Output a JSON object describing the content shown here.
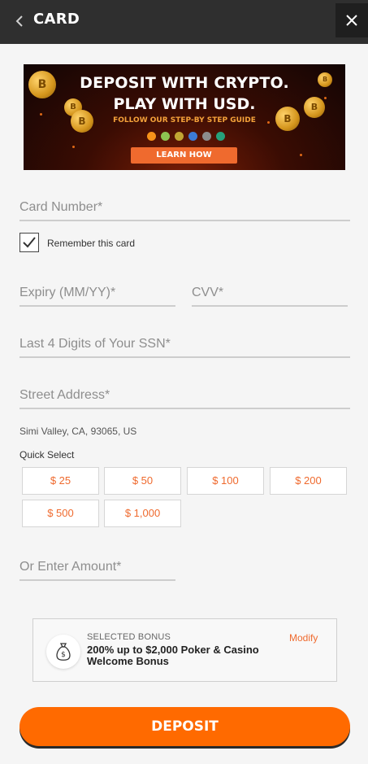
{
  "header": {
    "back_icon": "chevron-left-icon",
    "title": "CARD",
    "close_icon": "close-icon"
  },
  "banner": {
    "line1": "DEPOSIT WITH CRYPTO.",
    "line2": "PLAY WITH USD.",
    "guide": "FOLLOW OUR STEP-BY STEP GUIDE",
    "button_label": "LEARN HOW",
    "coin_letter": "B",
    "crypto_icons": [
      "bitcoin-icon",
      "bitcoin-cash-icon",
      "dogecoin-icon",
      "litecoin-icon",
      "ethereum-icon",
      "tether-icon"
    ],
    "crypto_colors": [
      "#f7931a",
      "#8dc351",
      "#c2a633",
      "#3c7bd6",
      "#8c8c8c",
      "#26a17b"
    ]
  },
  "form": {
    "card_number_placeholder": "Card Number*",
    "remember_label": "Remember this card",
    "remember_checked": true,
    "expiry_placeholder": "Expiry (MM/YY)*",
    "cvv_placeholder": "CVV*",
    "ssn_placeholder": "Last 4 Digits of Your SSN*",
    "street_placeholder": "Street Address*",
    "address_line": "Simi Valley, CA, 93065, US",
    "quick_select_label": "Quick Select",
    "quick_amounts": [
      "$ 25",
      "$ 50",
      "$ 100",
      "$ 200",
      "$ 500",
      "$ 1,000"
    ],
    "amount_placeholder": "Or Enter Amount*"
  },
  "bonus": {
    "icon": "money-bag-icon",
    "label": "SELECTED BONUS",
    "title": "200% up to $2,000 Poker & Casino Welcome Bonus",
    "modify_label": "Modify"
  },
  "deposit_label": "DEPOSIT",
  "colors": {
    "accent": "#ff6a00",
    "header_bg": "#2f2f2f",
    "background": "#f5f5f5"
  }
}
